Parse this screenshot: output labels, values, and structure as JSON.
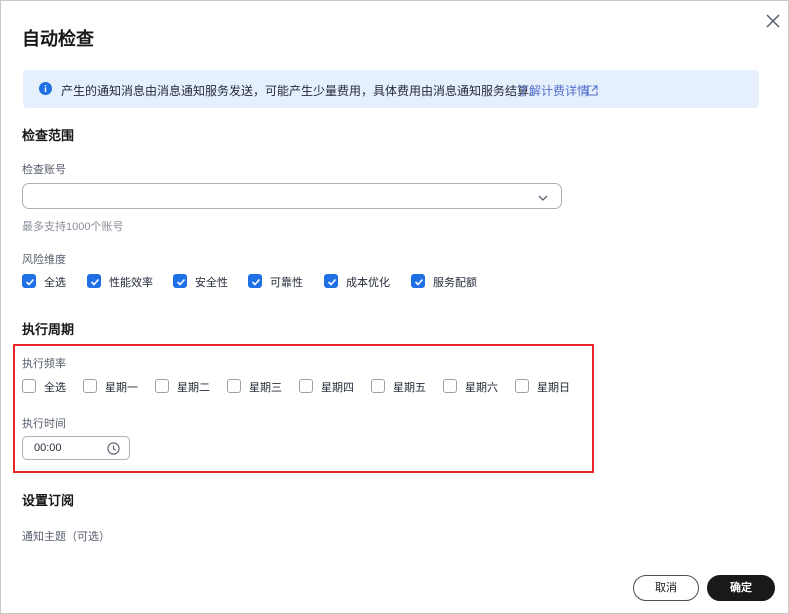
{
  "dialog": {
    "title": "自动检查",
    "close_icon": "close-icon"
  },
  "notice": {
    "icon": "info-icon",
    "text": "产生的通知消息由消息通知服务发送，可能产生少量费用，具体费用由消息通知服务结算。",
    "link": "了解计费详情",
    "link_icon": "external-link-icon"
  },
  "scope": {
    "title": "检查范围",
    "account_label": "检查账号",
    "account_value": "",
    "account_hint": "最多支持1000个账号",
    "risk_label": "风险维度",
    "risk_options": [
      {
        "label": "全选",
        "checked": true
      },
      {
        "label": "性能效率",
        "checked": true
      },
      {
        "label": "安全性",
        "checked": true
      },
      {
        "label": "可靠性",
        "checked": true
      },
      {
        "label": "成本优化",
        "checked": true
      },
      {
        "label": "服务配额",
        "checked": true
      }
    ]
  },
  "period": {
    "title": "执行周期",
    "frequency_label": "执行频率",
    "days": [
      {
        "label": "全选",
        "checked": false
      },
      {
        "label": "星期一",
        "checked": false
      },
      {
        "label": "星期二",
        "checked": false
      },
      {
        "label": "星期三",
        "checked": false
      },
      {
        "label": "星期四",
        "checked": false
      },
      {
        "label": "星期五",
        "checked": false
      },
      {
        "label": "星期六",
        "checked": false
      },
      {
        "label": "星期日",
        "checked": false
      }
    ],
    "time_label": "执行时间",
    "time_value": "00:00",
    "time_icon": "clock-icon"
  },
  "subscription": {
    "title": "设置订阅",
    "topic_label": "通知主题（可选）"
  },
  "footer": {
    "cancel_label": "取消",
    "ok_label": "确定"
  },
  "colors": {
    "accent": "#1f6fe5",
    "notice_bg": "#e6f0fd",
    "highlight": "#e8252b",
    "primary_button": "#191919"
  }
}
